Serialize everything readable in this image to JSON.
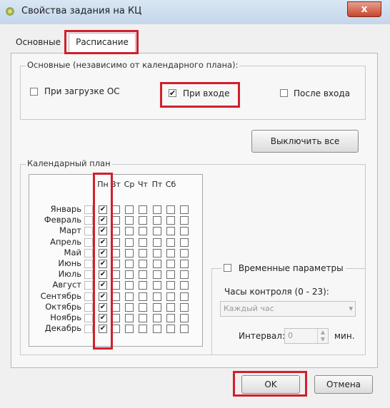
{
  "window": {
    "title": "Свойства задания на КЦ",
    "close_glyph": "x"
  },
  "tabs": [
    {
      "label": "Основные",
      "active": false
    },
    {
      "label": "Расписание",
      "active": true
    }
  ],
  "general_group": {
    "label": "Основные (независимо от календарного плана):",
    "options": [
      {
        "label": "При загрузке ОС",
        "checked": false
      },
      {
        "label": "При входе",
        "checked": true
      },
      {
        "label": "После входа",
        "checked": false
      }
    ]
  },
  "disable_all_button": "Выключить все",
  "calendar": {
    "label": "Календарный план",
    "days": [
      "Пн",
      "Вт",
      "Ср",
      "Чт",
      "Пт",
      "Сб"
    ],
    "months": [
      "Январь",
      "Февраль",
      "Март",
      "Апрель",
      "Май",
      "Июнь",
      "Июль",
      "Август",
      "Сентябрь",
      "Октябрь",
      "Ноябрь",
      "Декабрь"
    ],
    "checked_day_index": 0
  },
  "time_params": {
    "label": "Временные параметры",
    "checked": false,
    "hours_label": "Часы контроля (0 - 23):",
    "hours_value": "Каждый час",
    "interval_label": "Интервал:",
    "interval_value": "0",
    "interval_unit": "мин."
  },
  "footer": {
    "ok": "OK",
    "cancel": "Отмена"
  },
  "colors": {
    "highlight": "#d0202c"
  }
}
